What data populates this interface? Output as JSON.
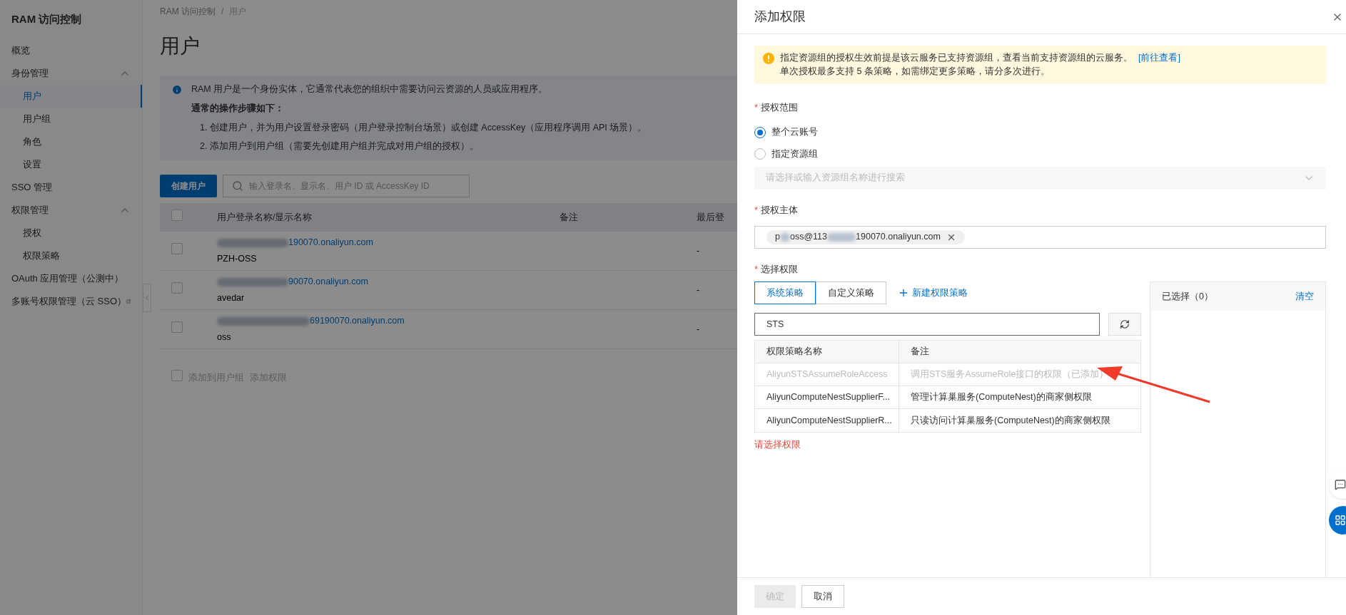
{
  "sidebar": {
    "title": "RAM 访问控制",
    "items": [
      {
        "label": "概览",
        "selected": false
      },
      {
        "label": "身份管理",
        "selected": false,
        "expanded": true,
        "children": [
          {
            "label": "用户",
            "selected": true
          },
          {
            "label": "用户组",
            "selected": false
          },
          {
            "label": "角色",
            "selected": false
          },
          {
            "label": "设置",
            "selected": false
          }
        ]
      },
      {
        "label": "SSO 管理",
        "selected": false
      },
      {
        "label": "权限管理",
        "selected": false,
        "expanded": true,
        "children": [
          {
            "label": "授权",
            "selected": false
          },
          {
            "label": "权限策略",
            "selected": false
          }
        ]
      },
      {
        "label": "OAuth 应用管理（公测中）",
        "selected": false
      },
      {
        "label": "多账号权限管理（云 SSO）",
        "selected": false,
        "external": true
      }
    ]
  },
  "breadcrumb": [
    "RAM 访问控制",
    "/",
    "用户"
  ],
  "page_title": "用户",
  "info": {
    "text": "RAM 用户是一个身份实体，它通常代表您的组织中需要访问云资源的人员或应用程序。",
    "steps_title": "通常的操作步骤如下：",
    "steps": [
      "1. 创建用户，并为用户设置登录密码（用户登录控制台场景）或创建 AccessKey（应用程序调用 API 场景）。",
      "2. 添加用户到用户组（需要先创建用户组并完成对用户组的授权）。"
    ]
  },
  "create_button": "创建用户",
  "search": {
    "placeholder": "输入登录名、显示名、用户 ID 或 AccessKey ID"
  },
  "table": {
    "columns": [
      "用户登录名称/显示名称",
      "备注",
      "最后登"
    ],
    "rows": [
      {
        "checked": false,
        "login": "190070.onaliyun.com",
        "display": "PZH-OSS",
        "note": "",
        "last": "-"
      },
      {
        "checked": false,
        "login": "90070.onaliyun.com",
        "display": "avedar",
        "note": "",
        "last": "-"
      },
      {
        "checked": false,
        "login": "69190070.onaliyun.com",
        "display": "oss",
        "note": "",
        "last": "-"
      }
    ]
  },
  "bulk_actions": {
    "checked": false,
    "actions": [
      "添加到用户组",
      "添加权限"
    ]
  },
  "drawer": {
    "title": "添加权限",
    "alert": {
      "line1": "指定资源组的授权生效前提是该云服务已支持资源组，查看当前支持资源组的云服务。",
      "link": "[前往查看]",
      "line2": "单次授权最多支持 5 条策略，如需绑定更多策略，请分多次进行。"
    },
    "required_mark": "*",
    "scope": {
      "label": "授权范围",
      "options": [
        {
          "label": "整个云账号",
          "selected": true
        },
        {
          "label": "指定资源组",
          "selected": false
        }
      ],
      "select_placeholder": "请选择或输入资源组名称进行搜索"
    },
    "principal": {
      "label": "授权主体",
      "tag": [
        "p",
        "oss@113",
        "190070.onaliyun.com"
      ]
    },
    "permissions": {
      "label": "选择权限",
      "tabs": [
        {
          "label": "系统策略",
          "selected": true
        },
        {
          "label": "自定义策略",
          "selected": false
        }
      ],
      "new_policy": "新建权限策略",
      "search_value": "STS",
      "columns": [
        "权限策略名称",
        "备注"
      ],
      "rows": [
        {
          "name": "AliyunSTSAssumeRoleAccess",
          "note": "调用STS服务AssumeRole接口的权限（已添加）",
          "disabled": true
        },
        {
          "name": "AliyunComputeNestSupplierF...",
          "note": "管理计算巢服务(ComputeNest)的商家侧权限",
          "disabled": false
        },
        {
          "name": "AliyunComputeNestSupplierR...",
          "note": "只读访问计算巢服务(ComputeNest)的商家侧权限",
          "disabled": false
        }
      ],
      "error": "请选择权限",
      "selected_title": "已选择（0）",
      "clear": "清空"
    },
    "ok": {
      "label": "确定",
      "disabled": true
    },
    "cancel": "取消"
  }
}
